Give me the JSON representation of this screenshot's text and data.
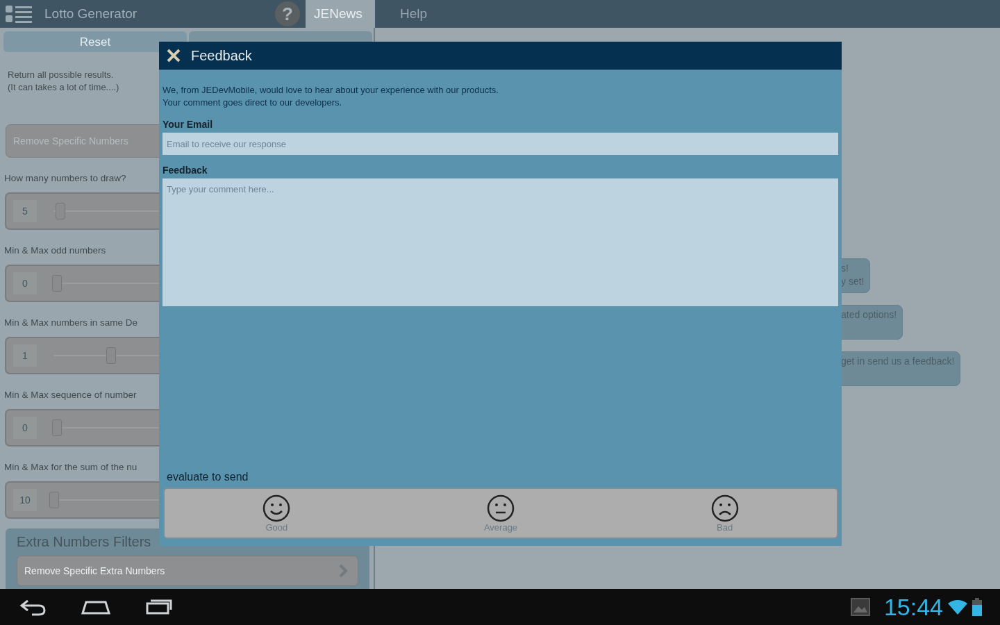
{
  "app_bar": {
    "title": "Lotto Generator",
    "help_icon": "?",
    "tabs": [
      {
        "label": "JENews",
        "selected": true
      },
      {
        "label": "Help",
        "selected": false
      }
    ]
  },
  "left_panel": {
    "reset_button": "Reset",
    "note": [
      "Return all possible results.",
      "(It can takes a lot of time....)"
    ],
    "remove_button": "Remove Specific Numbers",
    "filters": [
      {
        "label": "How many numbers to draw?",
        "value": "5",
        "level": 0.02
      },
      {
        "label": "Min & Max odd numbers",
        "value": "0",
        "level": 0.01
      },
      {
        "label": "Min & Max numbers in same De",
        "value": "1",
        "level": 0.19
      },
      {
        "label": "Min & Max sequence of number",
        "value": "0",
        "level": 0.01
      },
      {
        "label": "Min & Max for the sum of the nu",
        "value": "10",
        "level": 0
      }
    ],
    "extra_filters": {
      "title": "Extra Numbers Filters",
      "button": "Remove Specific Extra Numbers"
    }
  },
  "hints": [
    {
      "lines": [
        "s!",
        "y set!"
      ]
    },
    {
      "lines": [
        "ated options!"
      ]
    },
    {
      "lines": [
        "get in send us a feedback!"
      ]
    }
  ],
  "dialog": {
    "title": "Feedback",
    "intro": [
      "We, from JEDevMobile, would love to hear about your experience with our products.",
      "Your comment goes direct to our developers."
    ],
    "email": {
      "label": "Your Email",
      "placeholder": "Email to receive our response"
    },
    "feedback": {
      "label": "Feedback",
      "placeholder": "Type your comment here..."
    },
    "rating_label": "evaluate to send",
    "ratings": [
      {
        "kind": "good",
        "label": "Good"
      },
      {
        "kind": "average",
        "label": "Average"
      },
      {
        "kind": "bad",
        "label": "Bad"
      }
    ]
  },
  "nav_bar": {
    "time": "15:44"
  }
}
